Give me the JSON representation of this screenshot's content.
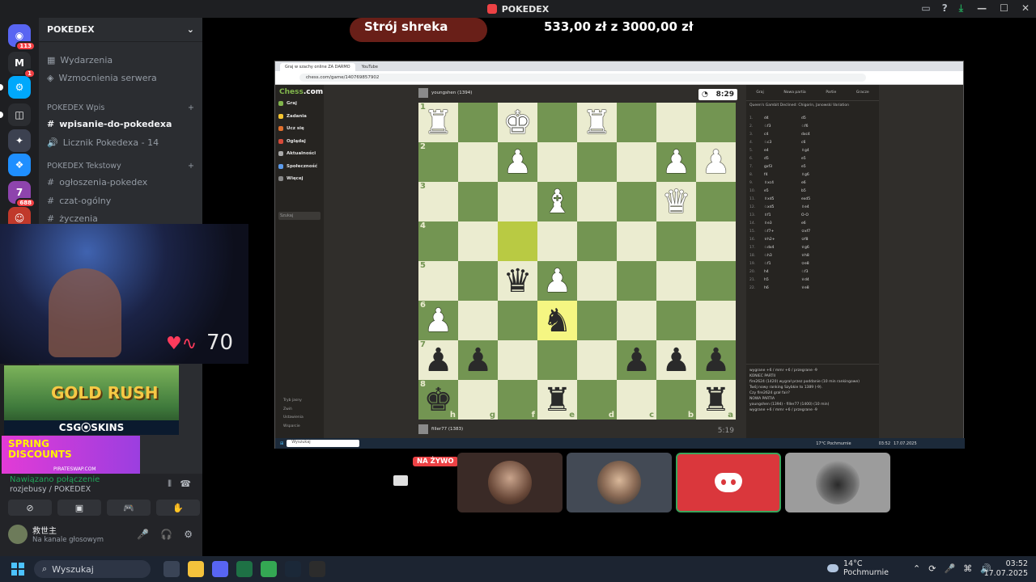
{
  "window": {
    "title": "POKEDEX",
    "controls": [
      "—",
      "☐",
      "✕"
    ]
  },
  "rail": {
    "servers": [
      {
        "glyph": "◉",
        "color": "#5865f2",
        "badge": "113"
      },
      {
        "glyph": "M",
        "color": "#2b2d31",
        "badge": "1"
      },
      {
        "glyph": "⚙",
        "color": "#00a8fc",
        "badge": ""
      },
      {
        "glyph": "◫",
        "color": "#2b2d31",
        "badge": ""
      },
      {
        "glyph": "✦",
        "color": "#3c4150",
        "badge": ""
      },
      {
        "glyph": "❖",
        "color": "#1f8fff",
        "badge": ""
      },
      {
        "glyph": "7",
        "color": "#8e44ad",
        "badge": "688"
      },
      {
        "glyph": "☺",
        "color": "#c0392b",
        "badge": "78"
      }
    ]
  },
  "guild": {
    "name": "POKEDEX",
    "top_channels": [
      {
        "icon": "▦",
        "label": "Wydarzenia"
      },
      {
        "icon": "◈",
        "label": "Wzmocnienia serwera"
      }
    ],
    "cat1": "POKEDEX Wpis",
    "cat1_channels": [
      {
        "icon": "#",
        "label": "wpisanie-do-pokedexa",
        "active": true
      },
      {
        "icon": "🔊",
        "label": "Licznik Pokedexa - 14",
        "active": false
      }
    ],
    "cat2": "POKEDEX Tekstowy",
    "cat2_channels": [
      {
        "icon": "#",
        "label": "ogłoszenia-pokedex"
      },
      {
        "icon": "#",
        "label": "czat-ogólny"
      },
      {
        "icon": "#",
        "label": "życzenia"
      }
    ]
  },
  "overlay": {
    "bpm": "70",
    "ad1_title": "GOLD RUSH",
    "ad1_brand": "CSG⦿SKINS",
    "ad2_title": "SPRING DISCOUNTS",
    "ad2_brand": "PIRATESWAP.COM"
  },
  "voice": {
    "status": "Nawiązano połączenie",
    "channel": "rozjebusy / POKEDEX",
    "buttons": [
      "⊘",
      "▣",
      "🎮",
      "✋"
    ],
    "user": {
      "name": "救世主",
      "status": "Na kanale głosowym"
    },
    "controls": [
      "🎤",
      "🎧",
      "⚙"
    ]
  },
  "stream": {
    "donation_title": "Strój shreka",
    "donation_amount": "533,00 zł z 3000,00 zł",
    "live_badge": "NA ŻYWO"
  },
  "browser": {
    "tabs": [
      "Graj w szachy online ZA DARMO",
      "YouTube"
    ],
    "url": "chess.com/game/140769857902"
  },
  "chess": {
    "logo_a": "Chess",
    "logo_b": ".com",
    "nav": [
      {
        "label": "Graj",
        "color": "#81b64c"
      },
      {
        "label": "Zadania",
        "color": "#f7c631"
      },
      {
        "label": "Ucz się",
        "color": "#e2702d"
      },
      {
        "label": "Oglądaj",
        "color": "#d84a3a"
      },
      {
        "label": "Aktualności",
        "color": "#aaaaaa"
      },
      {
        "label": "Społeczność",
        "color": "#5d9cec"
      },
      {
        "label": "Więcej",
        "color": "#888888"
      }
    ],
    "search_placeholder": "Szukaj",
    "footer": [
      "Tryb jasny",
      "Zwiń",
      "Ustawienia",
      "Wsparcie"
    ],
    "top_player": "youngshen (1394)",
    "bottom_player": "filler77 (1383)",
    "top_clock": "8:29",
    "bottom_clock": "5:19",
    "board": [
      [
        "wr",
        "",
        "wk",
        "",
        "wr",
        "",
        "",
        ""
      ],
      [
        "",
        "",
        "wp",
        "",
        "",
        "",
        "wp",
        "wp"
      ],
      [
        "",
        "",
        "",
        "wb",
        "",
        "",
        "wq",
        ""
      ],
      [
        "",
        "",
        "",
        "",
        "",
        "",
        "",
        ""
      ],
      [
        "",
        "",
        "bq",
        "wp",
        "",
        "",
        "",
        ""
      ],
      [
        "wp",
        "",
        "",
        "bn",
        "",
        "",
        "",
        ""
      ],
      [
        "bp",
        "bp",
        "",
        "",
        "",
        "bp",
        "bp",
        "bp"
      ],
      [
        "bk",
        "",
        "",
        "br",
        "",
        "",
        "",
        "br"
      ]
    ],
    "ranks": [
      "1",
      "2",
      "3",
      "4",
      "5",
      "6",
      "7",
      "8"
    ],
    "files": [
      "h",
      "g",
      "f",
      "e",
      "d",
      "c",
      "b",
      "a"
    ],
    "panel_tabs": [
      "Graj",
      "Nowa partia",
      "Partie",
      "Gracze"
    ],
    "opening": "Queen's Gambit Declined: Chigorin, Janowski Variation",
    "moves": [
      [
        "1.",
        "d4",
        "d5"
      ],
      [
        "2.",
        "♘f3",
        "♘f6"
      ],
      [
        "3.",
        "c4",
        "dxc4"
      ],
      [
        "4.",
        "♘c3",
        "c6"
      ],
      [
        "5.",
        "e4",
        "♗g4"
      ],
      [
        "6.",
        "d5",
        "e5"
      ],
      [
        "7.",
        "gxf3",
        "e5"
      ],
      [
        "8.",
        "f4",
        "♗g6"
      ],
      [
        "9.",
        "♗xc4",
        "e6"
      ],
      [
        "10.",
        "e5",
        "b5"
      ],
      [
        "11.",
        "♗xd5",
        "exd5"
      ],
      [
        "12.",
        "♘xd5",
        "♗e4"
      ],
      [
        "13.",
        "♗f1",
        "O-O"
      ],
      [
        "14.",
        "♗e3",
        "e6"
      ],
      [
        "15.",
        "♘f7+",
        "♔xf7"
      ],
      [
        "16.",
        "♕h2+",
        "♔f8"
      ],
      [
        "17.",
        "♘dx4",
        "♕g6"
      ],
      [
        "18.",
        "♘h3",
        "♕h8"
      ],
      [
        "19.",
        "♘f1",
        "♔e8"
      ],
      [
        "20.",
        "h4",
        "♘f3"
      ],
      [
        "21.",
        "h5",
        "♕d4"
      ],
      [
        "22.",
        "h6",
        "♕e8"
      ]
    ],
    "chat": [
      "wygrane +6 / mmr +6 / przegrane -9",
      "KONIEC PARTII",
      "fire2624 (1420) wygrał przez poddanie (10 min rankingowe)",
      "Twój nowy ranking Szybkie to 1389 (-9).",
      "Czy fire2624 grał fair?",
      "NOWA PARTIA",
      "youngshen (1394) - filler77 (1400) (10 min)",
      "wygrane +6 / mmr +6 / przegrane -9"
    ]
  },
  "inner_taskbar": {
    "search": "Wyszukaj",
    "weather": "17°C Pochmurnie",
    "time": "03:52",
    "date": "17.07.2025"
  },
  "taskbar": {
    "search": "Wyszukaj",
    "temp": "14°C",
    "weather": "Pochmurnie",
    "time": "03:52",
    "date": "17.07.2025"
  }
}
